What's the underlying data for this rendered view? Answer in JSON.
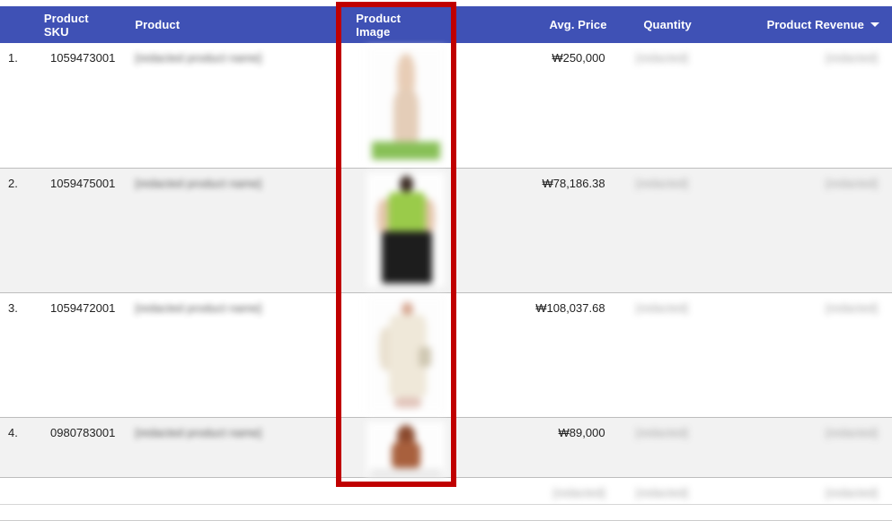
{
  "table": {
    "columns": [
      {
        "key": "index",
        "label": "",
        "icon": ""
      },
      {
        "key": "sku",
        "label": "Product\nSKU",
        "icon": ""
      },
      {
        "key": "product",
        "label": "Product",
        "icon": ""
      },
      {
        "key": "image",
        "label": "Product\nImage",
        "icon": ""
      },
      {
        "key": "price",
        "label": "Avg. Price",
        "icon": ""
      },
      {
        "key": "qty",
        "label": "Quantity",
        "icon": ""
      },
      {
        "key": "revenue",
        "label": "Product Revenue",
        "icon": "sort-descending-caret-icon"
      }
    ],
    "sorted_column": "Product Revenue",
    "rows": [
      {
        "index": "1.",
        "sku": "1059473001",
        "product": "[redacted product name]",
        "image_alt": "product photo 1",
        "avg_price": "₩250,000",
        "quantity": "[redacted]",
        "revenue": "[redacted]"
      },
      {
        "index": "2.",
        "sku": "1059475001",
        "product": "[redacted product name]",
        "image_alt": "product photo 2",
        "avg_price": "₩78,186.38",
        "quantity": "[redacted]",
        "revenue": "[redacted]"
      },
      {
        "index": "3.",
        "sku": "1059472001",
        "product": "[redacted product name]",
        "image_alt": "product photo 3",
        "avg_price": "₩108,037.68",
        "quantity": "[redacted]",
        "revenue": "[redacted]"
      },
      {
        "index": "4.",
        "sku": "0980783001",
        "product": "[redacted product name]",
        "image_alt": "product photo 4",
        "avg_price": "₩89,000",
        "quantity": "[redacted]",
        "revenue": "[redacted]"
      }
    ],
    "totals_row": {
      "price": "[redacted]",
      "quantity": "[redacted]",
      "revenue": "[redacted]"
    }
  },
  "annotation": {
    "type": "highlight-rectangle",
    "target_column": "Product Image",
    "color": "#c00000"
  },
  "theme": {
    "header_background": "#3f51b5",
    "header_text": "#ffffff",
    "row_alt_background": "#f2f2f2",
    "row_background": "#ffffff",
    "body_text": "#222222",
    "row_divider": "#bdbdbd"
  }
}
